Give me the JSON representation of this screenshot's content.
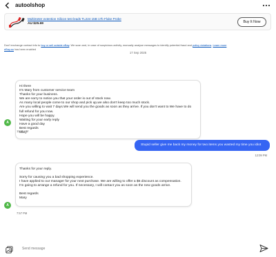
{
  "header": {
    "back_icon": "chevron-left-icon",
    "shop_name": "autoolshop",
    "more_icon": "more-icon"
  },
  "product": {
    "title": "Multimeter extention Silicon test leads TL224 15B 17b Fluke Probe",
    "price": "AU $25.69",
    "buy_label": "Buy It Now"
  },
  "notice": {
    "text_before": "Don't exchange contact info to ",
    "link1": "buy or sell outside eBay",
    "text_middle": ". We scan and, in case of suspicious activity, manually analyse messages to identify potential fraud and ",
    "link2": "policy violations",
    "text_after": ". ",
    "link3": "Learn more",
    "line2_link": "eBay.au",
    "line2_text": " has been enabled"
  },
  "date_divider": "17 Sep 2025",
  "messages": {
    "seller1": {
      "avatar_initial": "A",
      "lines": [
        "Hi there",
        "It's Mary from customer service team",
        "Thanks for your business.",
        "We are sorry to notice you that your order is out of stock now.",
        "As many local people come to our shop and pick up,we also don't keep too much stock.",
        "Are you willing to wait 7 days.We will send you the goods as soon as they arrive. If you don't want to We have to do",
        "full refund for you now.",
        "Hope you will be happy.",
        "Waiting for your early reply",
        "Have a good day",
        "Best regards",
        "Mary"
      ],
      "time": "11:26 AM"
    },
    "buyer1": {
      "text": "Stupid seller give me back my money for two items you wasted my time you idiot",
      "time": "12:09 PM"
    },
    "seller2": {
      "avatar_initial": "A",
      "greeting": "Thanks for your reply.",
      "body": [
        "Sorry for causing you a bad shopping experience.",
        "I have applied to our manager for your next purchase. We are willing to offer a $5 discount as compensation.",
        "I'm going to arrange a refund for you. If necessary, I will contact you as soon as the new goods arrive."
      ],
      "signoff": "Best regards",
      "name": "Mary",
      "time": "7:57 PM"
    }
  },
  "composer": {
    "placeholder": "Send message",
    "image_icon": "image-icon",
    "send_icon": "send-icon"
  },
  "colors": {
    "accent": "#3665f3",
    "link": "#0654ba",
    "avatar": "#50b848"
  }
}
